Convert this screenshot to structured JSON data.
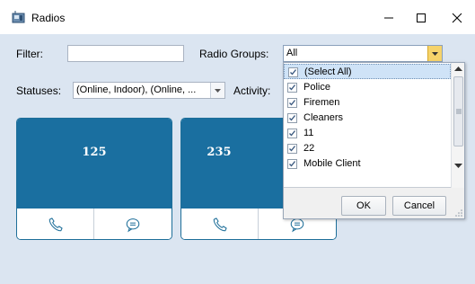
{
  "window": {
    "title": "Radios"
  },
  "filter": {
    "label": "Filter:",
    "value": ""
  },
  "radio_groups": {
    "label": "Radio Groups:",
    "value": "All"
  },
  "statuses": {
    "label": "Statuses:",
    "value": "(Online, Indoor), (Online, ..."
  },
  "activity": {
    "label": "Activity:"
  },
  "tiles": [
    {
      "number": "125"
    },
    {
      "number": "235"
    }
  ],
  "dropdown": {
    "items": [
      {
        "label": "(Select All)",
        "checked": true,
        "selected": true
      },
      {
        "label": "Police",
        "checked": true
      },
      {
        "label": "Firemen",
        "checked": true
      },
      {
        "label": "Cleaners",
        "checked": true
      },
      {
        "label": "11",
        "checked": true
      },
      {
        "label": "22",
        "checked": true
      },
      {
        "label": "Mobile Client",
        "checked": true
      }
    ],
    "ok_label": "OK",
    "cancel_label": "Cancel"
  },
  "colors": {
    "tile_header": "#1a6fa0",
    "background": "#dbe5f1",
    "accent_yellow": "#f6d36b"
  },
  "icons": [
    "radios-app-icon",
    "minimize-icon",
    "maximize-icon",
    "close-icon",
    "chevron-down-icon",
    "phone-icon",
    "chat-icon",
    "checkmark-icon",
    "scroll-up-icon",
    "scroll-down-icon",
    "resize-grip-icon"
  ]
}
